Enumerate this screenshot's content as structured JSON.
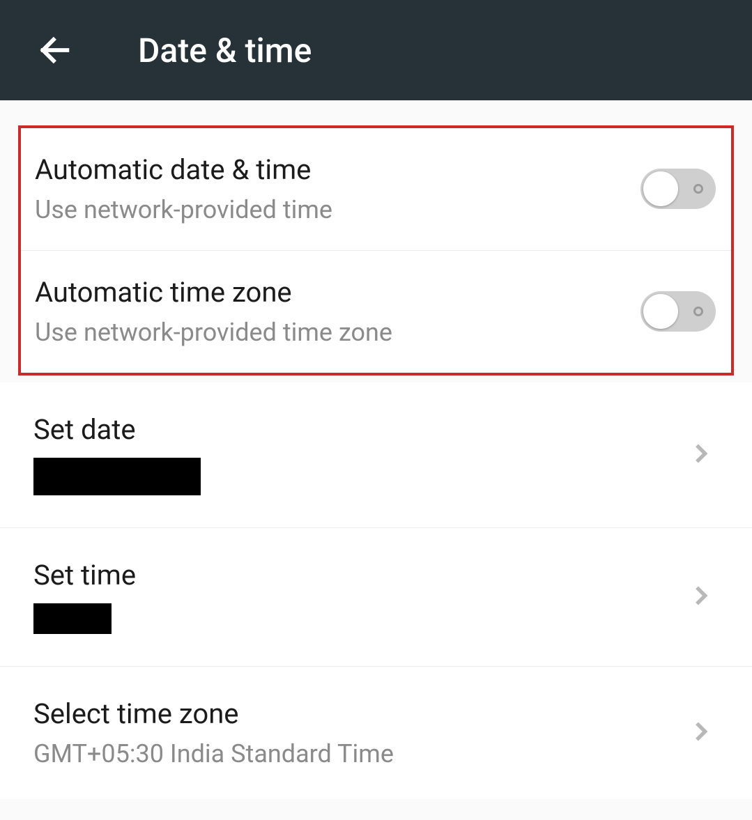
{
  "header": {
    "title": "Date & time"
  },
  "settings": {
    "auto_date_time": {
      "title": "Automatic date & time",
      "sub": "Use network-provided time"
    },
    "auto_time_zone": {
      "title": "Automatic time zone",
      "sub": "Use network-provided time zone"
    },
    "set_date": {
      "title": "Set date"
    },
    "set_time": {
      "title": "Set time"
    },
    "select_time_zone": {
      "title": "Select time zone",
      "sub": "GMT+05:30 India Standard Time"
    }
  }
}
